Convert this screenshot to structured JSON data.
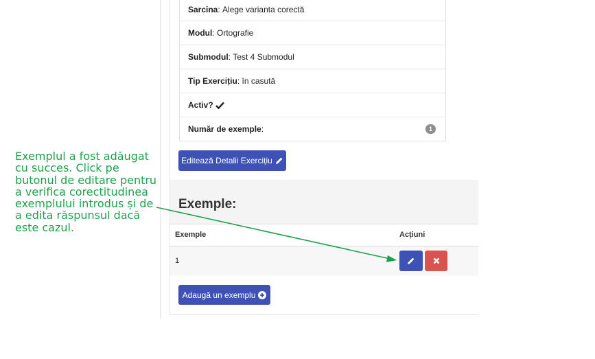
{
  "annotation": {
    "text": "Exemplul a fost adăugat cu succes. Click pe butonul de editare pentru a verifica corectitudinea exemplului introdus și de a edita răspunsul dacă este cazul."
  },
  "details": [
    {
      "label": "Sarcina",
      "value": "Alege varianta corectă"
    },
    {
      "label": "Modul",
      "value": "Ortografie"
    },
    {
      "label": "Submodul",
      "value": "Test 4 Submodul"
    },
    {
      "label": "Tip Exercițiu",
      "value": "în casută"
    }
  ],
  "active_label": "Activ?",
  "examples_count": {
    "label": "Număr de exemple",
    "suffix": ":",
    "value": "1"
  },
  "edit_details_button": "Editează Detalii Exercițiu",
  "examples_section": {
    "title": "Exemple:",
    "columns": [
      "Exemple",
      "Acțiuni"
    ],
    "rows": [
      {
        "example": "1"
      }
    ],
    "add_button": "Adaugă un exemplu"
  },
  "colors": {
    "primary": "#3e51b5",
    "danger": "#d9534f",
    "annotation": "#1ea14c"
  },
  "icons": [
    "pencil-icon",
    "close-icon",
    "check-icon",
    "plus-circle-icon"
  ]
}
